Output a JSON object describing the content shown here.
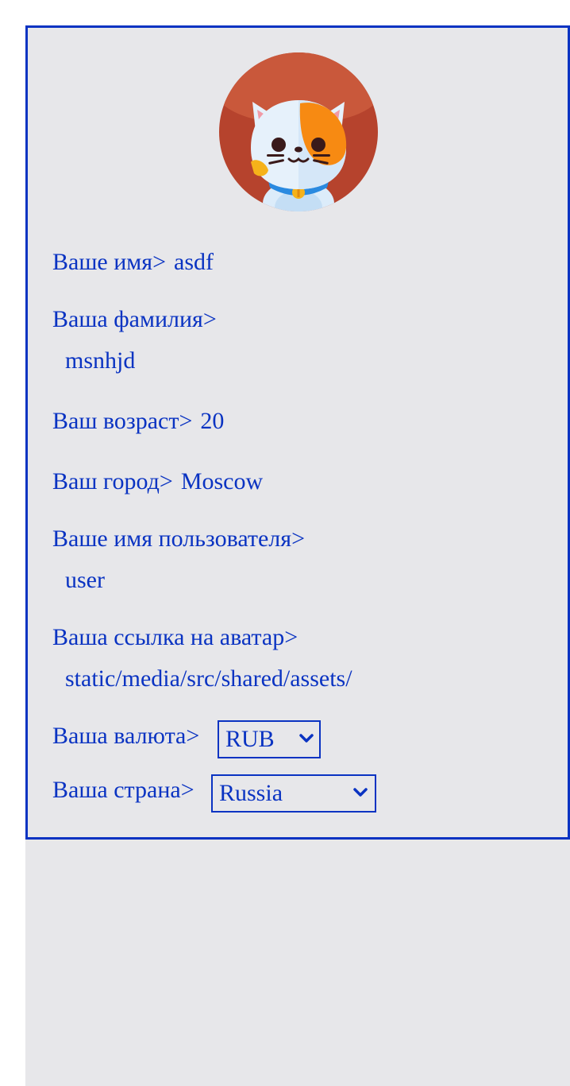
{
  "profile": {
    "first_name_label": "Ваше имя>",
    "first_name": "asdf",
    "last_name_label": "Ваша фамилия>",
    "last_name": "msnhjd",
    "age_label": "Ваш возраст>",
    "age": "20",
    "city_label": "Ваш город>",
    "city": "Moscow",
    "username_label": "Ваше имя пользователя>",
    "username": "user",
    "avatar_link_label": "Ваша ссылка на аватар>",
    "avatar_link": "static/media/src/shared/assets/",
    "currency_label": "Ваша валюта>",
    "currency": "RUB",
    "country_label": "Ваша страна>",
    "country": "Russia"
  },
  "avatar": {
    "icon": "cat-avatar-icon"
  },
  "colors": {
    "accent": "#0a33c2",
    "background": "#e7e7ea",
    "avatar_circle": "#b6432d"
  }
}
